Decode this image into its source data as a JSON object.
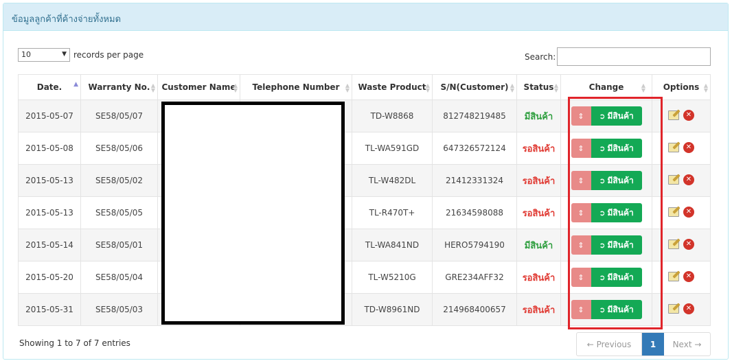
{
  "panel": {
    "title": "ข้อมูลลูกค้าที่ค้างจ่ายทั้งหมด"
  },
  "controls": {
    "length_value": "10",
    "length_label": "records per page",
    "search_label": "Search:"
  },
  "columns": [
    "Date.",
    "Warranty No.",
    "Customer Name",
    "Telephone Number",
    "Waste Product",
    "S/N(Customer)",
    "Status",
    "Change",
    "Options"
  ],
  "change_button_label": "มีสินค้า",
  "rows": [
    {
      "date": "2015-05-07",
      "warranty": "SE58/05/07",
      "product": "TD-W8868",
      "sn": "812748219485",
      "status": "มีสินค้า",
      "status_color": "#2e9e3e"
    },
    {
      "date": "2015-05-08",
      "warranty": "SE58/05/06",
      "product": "TL-WA591GD",
      "sn": "647326572124",
      "status": "รอสินค้า",
      "status_color": "#e03a33"
    },
    {
      "date": "2015-05-13",
      "warranty": "SE58/05/02",
      "product": "TL-W482DL",
      "sn": "21412331324",
      "status": "รอสินค้า",
      "status_color": "#e03a33"
    },
    {
      "date": "2015-05-13",
      "warranty": "SE58/05/05",
      "product": "TL-R470T+",
      "sn": "21634598088",
      "status": "รอสินค้า",
      "status_color": "#e03a33"
    },
    {
      "date": "2015-05-14",
      "warranty": "SE58/05/01",
      "product": "TL-WA841ND",
      "sn": "HERO5794190",
      "status": "มีสินค้า",
      "status_color": "#2e9e3e"
    },
    {
      "date": "2015-05-20",
      "warranty": "SE58/05/04",
      "product": "TL-W5210G",
      "sn": "GRE234AFF32",
      "status": "รอสินค้า",
      "status_color": "#e03a33"
    },
    {
      "date": "2015-05-31",
      "warranty": "SE58/05/03",
      "product": "TD-W8961ND",
      "sn": "214968400657",
      "status": "รอสินค้า",
      "status_color": "#e03a33"
    }
  ],
  "footer": {
    "info": "Showing 1 to 7 of 7 entries",
    "prev": "← Previous",
    "current_page": "1",
    "next": "Next →"
  },
  "colors": {
    "accent": "#337ab7",
    "change_button": "#14a955",
    "highlight_box": "#e0242a"
  }
}
